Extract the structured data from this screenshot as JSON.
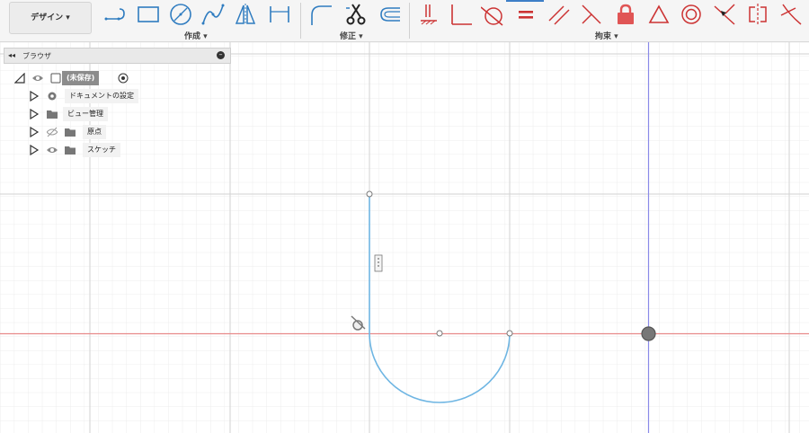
{
  "toolbar": {
    "design_label": "デザイン ▾",
    "groups": {
      "create": "作成 ▾",
      "modify": "修正 ▾",
      "constraints": "拘束 ▾"
    }
  },
  "browser": {
    "collapse_glyph": "◂◂",
    "title": "ブラウザ",
    "minimize_glyph": "–",
    "items": [
      {
        "label": "(未保存)"
      },
      {
        "label": "ドキュメントの設定"
      },
      {
        "label": "ビュー管理"
      },
      {
        "label": "原点"
      },
      {
        "label": "スケッチ"
      }
    ]
  },
  "colors": {
    "sketch_line": "#6fb6e3",
    "constraint_red": "#cc3333",
    "x_axis": "#e88a8a",
    "y_axis": "#8a8ae8",
    "grid_major": "#d2d2d2",
    "grid_minor": "#ececec"
  },
  "icons": [
    "line-icon",
    "rectangle-icon",
    "circle-icon",
    "spline-icon",
    "mirror-triangle-icon",
    "dimension-icon",
    "fillet-icon",
    "trim-scissors-icon",
    "offset-icon",
    "coincident-icon",
    "perpendicular-icon",
    "tangent-icon",
    "equal-icon",
    "parallel-icon",
    "perpendicular-cross-icon",
    "fix-lock-icon",
    "triangle-icon",
    "concentric-icon",
    "midpoint-icon",
    "symmetry-icon",
    "curvature-icon",
    "eye-icon",
    "gear-icon",
    "folder-icon",
    "target-icon"
  ]
}
